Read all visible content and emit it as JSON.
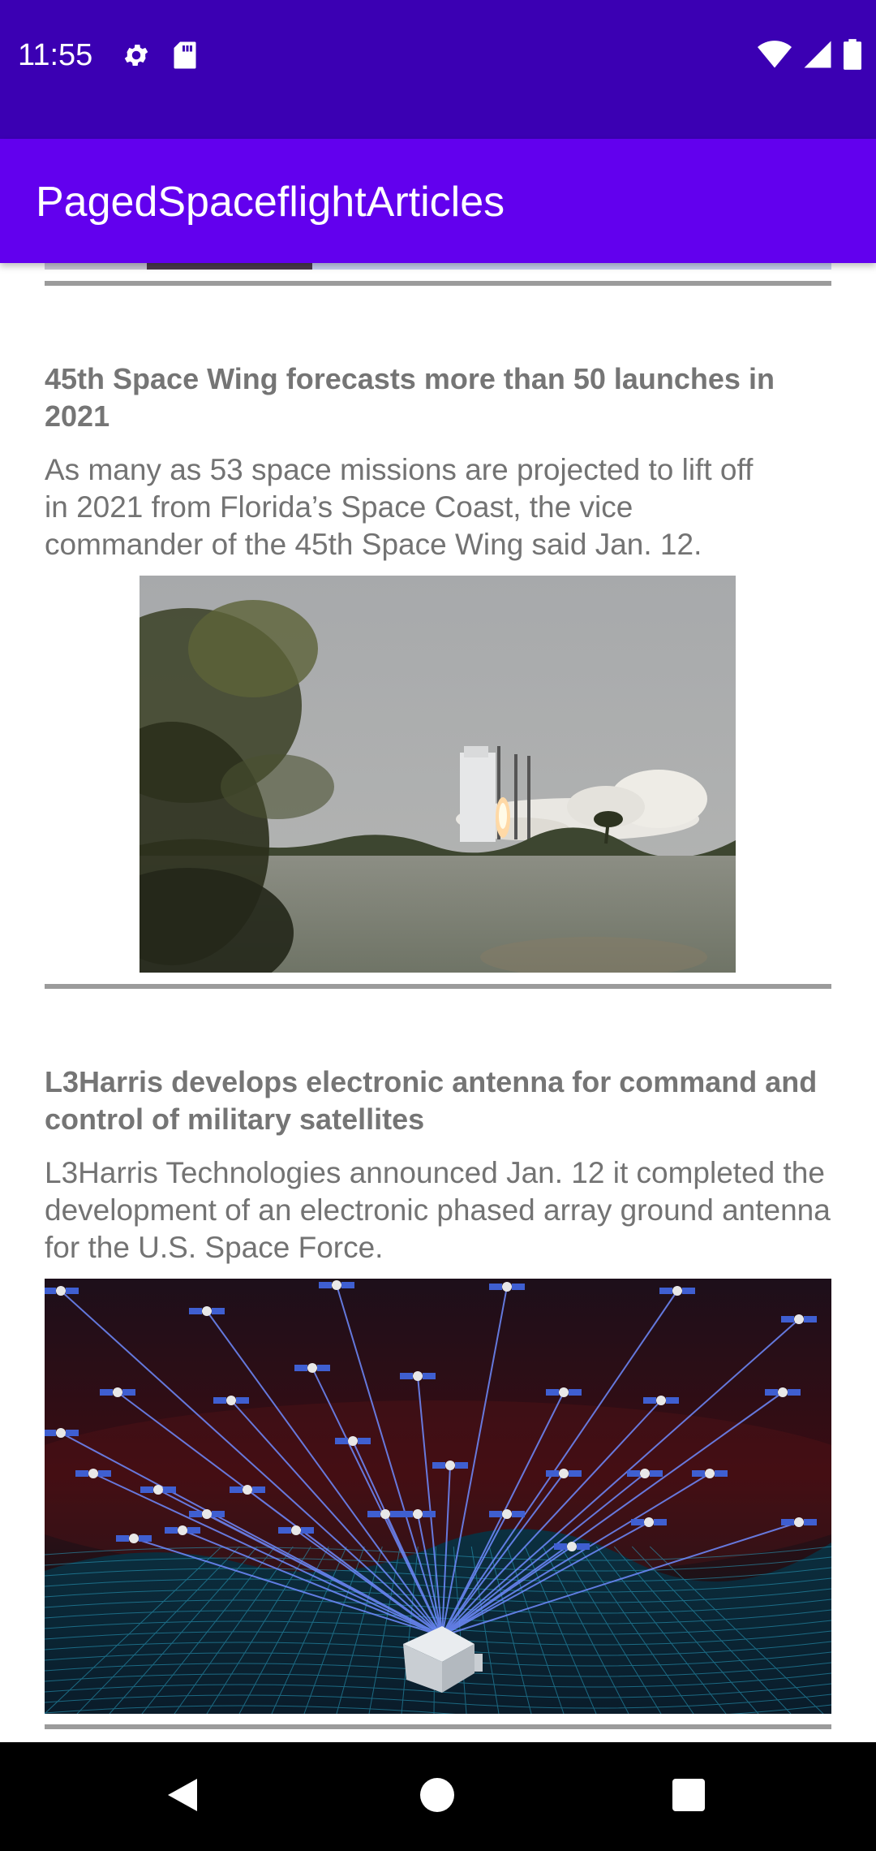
{
  "status_bar": {
    "time": "11:55",
    "left_icons": [
      "gear-icon",
      "sd-card-icon"
    ],
    "right_icons": [
      "wifi-icon",
      "cell-signal-icon",
      "battery-icon"
    ]
  },
  "app_bar": {
    "title": "PagedSpaceflightArticles"
  },
  "articles": [
    {
      "title": "45th Space Wing forecasts more than 50 launches in 2021",
      "summary": "As many as 53 space missions are projected to lift off in 2021 from Florida’s Space Coast, the vice commander of the 45th Space Wing said Jan. 12."
    },
    {
      "title": "L3Harris develops electronic antenna for command and control of military satellites",
      "summary": "L3Harris Technologies announced Jan. 12 it completed the development of an electronic phased array ground antenna for the U.S. Space Force."
    }
  ],
  "nav_bar": {
    "buttons": [
      "back-icon",
      "home-icon",
      "recents-icon"
    ]
  },
  "colors": {
    "status_bar": "#3b00b3",
    "app_bar": "#6200ee",
    "divider": "#9b9b9b",
    "text": "#757575",
    "nav_bar": "#000000"
  }
}
